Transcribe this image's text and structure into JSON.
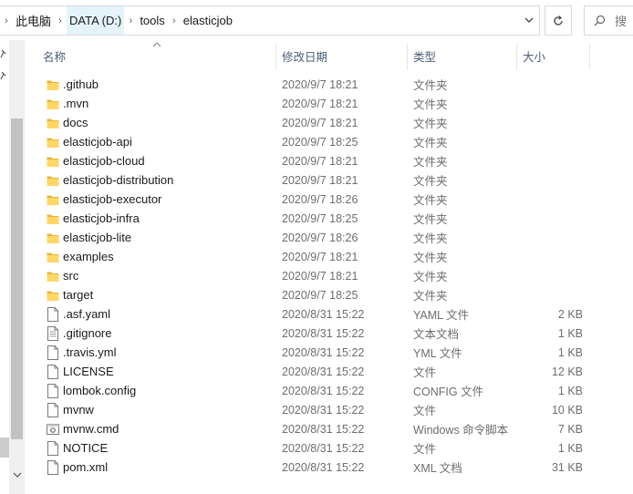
{
  "breadcrumb": {
    "items": [
      "此电脑",
      "DATA (D:)",
      "tools",
      "elasticjob"
    ]
  },
  "search": {
    "placeholder": "搜"
  },
  "columns": {
    "name": "名称",
    "date": "修改日期",
    "type": "类型",
    "size": "大小"
  },
  "files": [
    {
      "name": ".github",
      "date": "2020/9/7 18:21",
      "type": "文件夹",
      "size": "",
      "kind": "folder"
    },
    {
      "name": ".mvn",
      "date": "2020/9/7 18:21",
      "type": "文件夹",
      "size": "",
      "kind": "folder"
    },
    {
      "name": "docs",
      "date": "2020/9/7 18:21",
      "type": "文件夹",
      "size": "",
      "kind": "folder"
    },
    {
      "name": "elasticjob-api",
      "date": "2020/9/7 18:25",
      "type": "文件夹",
      "size": "",
      "kind": "folder"
    },
    {
      "name": "elasticjob-cloud",
      "date": "2020/9/7 18:21",
      "type": "文件夹",
      "size": "",
      "kind": "folder"
    },
    {
      "name": "elasticjob-distribution",
      "date": "2020/9/7 18:21",
      "type": "文件夹",
      "size": "",
      "kind": "folder"
    },
    {
      "name": "elasticjob-executor",
      "date": "2020/9/7 18:26",
      "type": "文件夹",
      "size": "",
      "kind": "folder"
    },
    {
      "name": "elasticjob-infra",
      "date": "2020/9/7 18:25",
      "type": "文件夹",
      "size": "",
      "kind": "folder"
    },
    {
      "name": "elasticjob-lite",
      "date": "2020/9/7 18:26",
      "type": "文件夹",
      "size": "",
      "kind": "folder"
    },
    {
      "name": "examples",
      "date": "2020/9/7 18:21",
      "type": "文件夹",
      "size": "",
      "kind": "folder"
    },
    {
      "name": "src",
      "date": "2020/9/7 18:21",
      "type": "文件夹",
      "size": "",
      "kind": "folder"
    },
    {
      "name": "target",
      "date": "2020/9/7 18:25",
      "type": "文件夹",
      "size": "",
      "kind": "folder"
    },
    {
      "name": ".asf.yaml",
      "date": "2020/8/31 15:22",
      "type": "YAML 文件",
      "size": "2 KB",
      "kind": "file"
    },
    {
      "name": ".gitignore",
      "date": "2020/8/31 15:22",
      "type": "文本文档",
      "size": "1 KB",
      "kind": "text"
    },
    {
      "name": ".travis.yml",
      "date": "2020/8/31 15:22",
      "type": "YML 文件",
      "size": "1 KB",
      "kind": "file"
    },
    {
      "name": "LICENSE",
      "date": "2020/8/31 15:22",
      "type": "文件",
      "size": "12 KB",
      "kind": "file"
    },
    {
      "name": "lombok.config",
      "date": "2020/8/31 15:22",
      "type": "CONFIG 文件",
      "size": "1 KB",
      "kind": "file"
    },
    {
      "name": "mvnw",
      "date": "2020/8/31 15:22",
      "type": "文件",
      "size": "10 KB",
      "kind": "file"
    },
    {
      "name": "mvnw.cmd",
      "date": "2020/8/31 15:22",
      "type": "Windows 命令脚本",
      "size": "7 KB",
      "kind": "cmd"
    },
    {
      "name": "NOTICE",
      "date": "2020/8/31 15:22",
      "type": "文件",
      "size": "1 KB",
      "kind": "file"
    },
    {
      "name": "pom.xml",
      "date": "2020/8/31 15:22",
      "type": "XML 文档",
      "size": "31 KB",
      "kind": "file"
    }
  ],
  "colors": {
    "folder": "#ffd766",
    "folder_dark": "#e8b536",
    "header_text": "#4c607a",
    "breadcrumb_active_bg": "#e5f3fb"
  }
}
